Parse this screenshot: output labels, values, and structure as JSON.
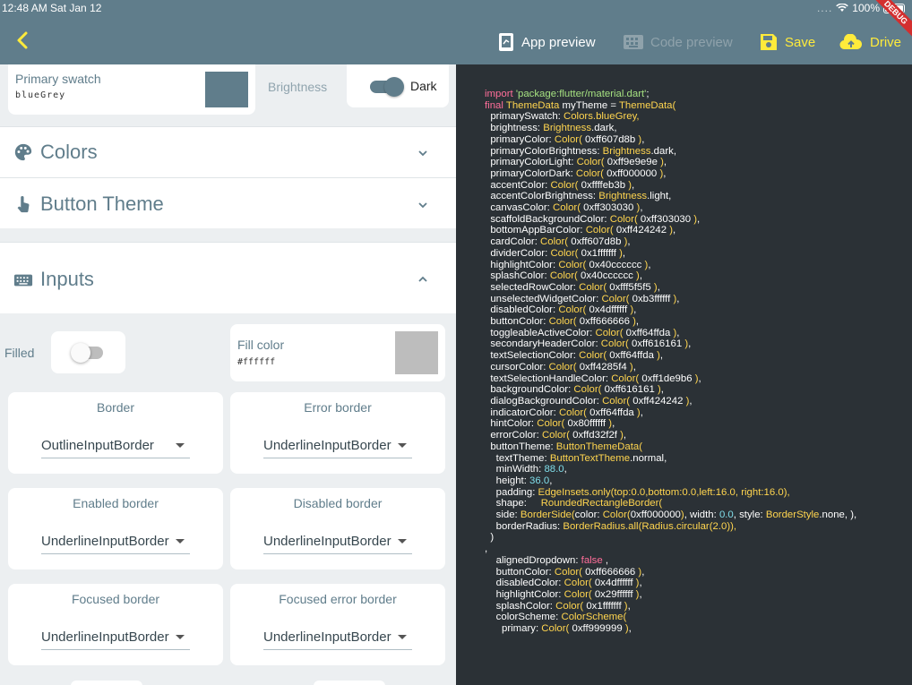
{
  "status_bar": {
    "time": "12:48 AM  Sat Jan 12",
    "battery": "100%",
    "debug_banner": "DEBUG"
  },
  "toolbar": {
    "back_icon": "chevron-left-icon",
    "app_preview": "App preview",
    "code_preview": "Code preview",
    "save": "Save",
    "drive": "Drive"
  },
  "colors": {
    "bar": "#607d8b",
    "accent": "#ffeb3b",
    "code_bg": "#2b3136",
    "swatch": "#607d8b",
    "fill": "#bdbdbd"
  },
  "primary_swatch": {
    "label": "Primary swatch",
    "value": "blueGrey"
  },
  "brightness": {
    "label": "Brightness",
    "value": "Dark"
  },
  "panels": {
    "colors": "Colors",
    "button_theme": "Button Theme",
    "inputs": "Inputs"
  },
  "inputs": {
    "filled_label": "Filled",
    "fill_color_label": "Fill color",
    "fill_color_value": "#ffffff",
    "borders": [
      {
        "title": "Border",
        "value": "OutlineInputBorder"
      },
      {
        "title": "Error border",
        "value": "UnderlineInputBorder"
      },
      {
        "title": "Enabled border",
        "value": "UnderlineInputBorder"
      },
      {
        "title": "Disabled border",
        "value": "UnderlineInputBorder"
      },
      {
        "title": "Focused border",
        "value": "UnderlineInputBorder"
      },
      {
        "title": "Focused error border",
        "value": "UnderlineInputBorder"
      }
    ]
  },
  "code": {
    "l0a": "import ",
    "l0b": "'package:flutter/material.dart'",
    "l0c": ";",
    "l1a": "final ",
    "l1b": "ThemeData ",
    "l1c": "myTheme = ",
    "l1d": "ThemeData(",
    "primarySwatch": "Colors.blueGrey,",
    "brightness": "Brightness",
    "primaryColor": "0xff607d8b",
    "primaryColorLight": "0xff9e9e9e",
    "primaryColorDark": "0xff000000",
    "accentColor": "0xffffeb3b",
    "canvasColor": "0xff303030",
    "scaffoldBackgroundColor": "0xff303030",
    "bottomAppBarColor": "0xff424242",
    "cardColor": "0xff607d8b",
    "dividerColor": "0x1fffffff",
    "highlightColor": "0x40cccccc",
    "splashColor": "0x40cccccc",
    "selectedRowColor": "0xfff5f5f5",
    "unselectedWidgetColor": "0xb3ffffff",
    "disabledColor": "0x4dffffff",
    "buttonColor": "0xff666666",
    "toggleableActiveColor": "0xff64ffda",
    "secondaryHeaderColor": "0xff616161",
    "textSelectionColor": "0xff64ffda",
    "cursorColor": "0xff4285f4",
    "textSelectionHandleColor": "0xff1de9b6",
    "backgroundColor": "0xff616161",
    "dialogBackgroundColor": "0xff424242",
    "indicatorColor": "0xff64ffda",
    "hintColor": "0x80ffffff",
    "errorColor": "0xffd32f2f",
    "minWidth": "88.0",
    "height": "36.0",
    "padding": "EdgeInsets.only(top:0.0,bottom:0.0,left:16.0, right:16.0),",
    "shape": "RoundedRectangleBorder(",
    "borderRadius": "BorderRadius.all(Radius.circular(2.0)),",
    "alignedDropdown": "false",
    "btnButtonColor": "0xff666666",
    "btnDisabledColor": "0x4dffffff",
    "btnHighlightColor": "0x29ffffff",
    "btnSplashColor": "0x1fffffff",
    "primaryPartial": "0xff999999"
  }
}
